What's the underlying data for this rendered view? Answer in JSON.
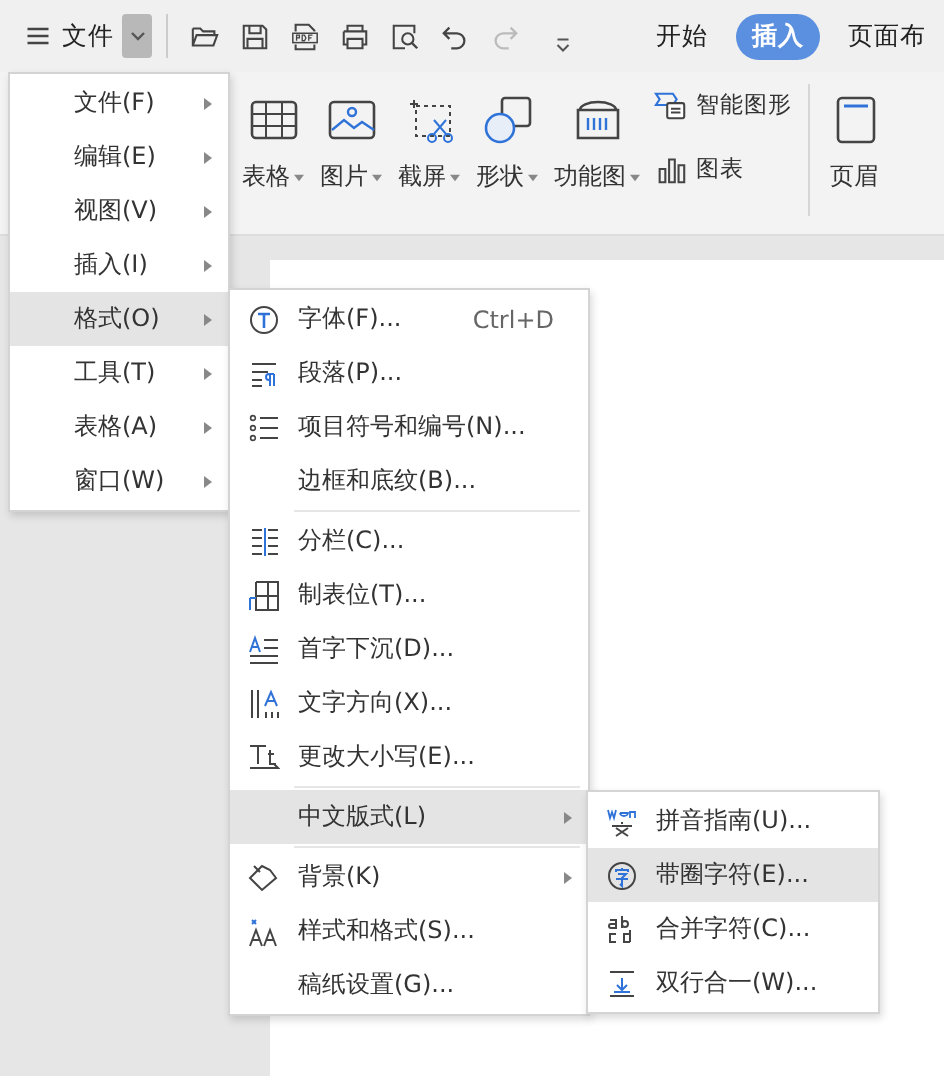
{
  "toolbar": {
    "menu_label": "文件",
    "tabs": [
      {
        "label": "开始",
        "selected": false
      },
      {
        "label": "插入",
        "selected": true
      },
      {
        "label": "页面布",
        "selected": false
      }
    ]
  },
  "ribbon": {
    "items": [
      {
        "label": "表格",
        "kind": "large"
      },
      {
        "label": "图片",
        "kind": "large"
      },
      {
        "label": "截屏",
        "kind": "large"
      },
      {
        "label": "形状",
        "kind": "large"
      },
      {
        "label": "功能图",
        "kind": "large"
      },
      {
        "label": "智能图形",
        "kind": "small"
      },
      {
        "label": "图表",
        "kind": "small"
      },
      {
        "label": "页眉",
        "kind": "cut"
      }
    ]
  },
  "main_menu": {
    "items": [
      {
        "label": "文件(F)",
        "selected": false
      },
      {
        "label": "编辑(E)",
        "selected": false
      },
      {
        "label": "视图(V)",
        "selected": false
      },
      {
        "label": "插入(I)",
        "selected": false
      },
      {
        "label": "格式(O)",
        "selected": true
      },
      {
        "label": "工具(T)",
        "selected": false
      },
      {
        "label": "表格(A)",
        "selected": false
      },
      {
        "label": "窗口(W)",
        "selected": false
      }
    ]
  },
  "format_menu": {
    "items": [
      {
        "kind": "item",
        "label": "字体(F)...",
        "shortcut": "Ctrl+D",
        "selected": false,
        "has_submenu": false
      },
      {
        "kind": "item",
        "label": "段落(P)...",
        "selected": false,
        "has_submenu": false
      },
      {
        "kind": "item",
        "label": "项目符号和编号(N)...",
        "selected": false,
        "has_submenu": false
      },
      {
        "kind": "item",
        "label": "边框和底纹(B)...",
        "selected": false,
        "has_submenu": false
      },
      {
        "kind": "separator"
      },
      {
        "kind": "item",
        "label": "分栏(C)...",
        "selected": false,
        "has_submenu": false
      },
      {
        "kind": "item",
        "label": "制表位(T)...",
        "selected": false,
        "has_submenu": false
      },
      {
        "kind": "item",
        "label": "首字下沉(D)...",
        "selected": false,
        "has_submenu": false
      },
      {
        "kind": "item",
        "label": "文字方向(X)...",
        "selected": false,
        "has_submenu": false
      },
      {
        "kind": "item",
        "label": "更改大小写(E)...",
        "selected": false,
        "has_submenu": false
      },
      {
        "kind": "separator"
      },
      {
        "kind": "item",
        "label": "中文版式(L)",
        "selected": true,
        "has_submenu": true
      },
      {
        "kind": "separator"
      },
      {
        "kind": "item",
        "label": "背景(K)",
        "selected": false,
        "has_submenu": true
      },
      {
        "kind": "item",
        "label": "样式和格式(S)...",
        "selected": false,
        "has_submenu": false
      },
      {
        "kind": "item",
        "label": "稿纸设置(G)...",
        "selected": false,
        "has_submenu": false
      }
    ]
  },
  "chinese_layout_menu": {
    "items": [
      {
        "label": "拼音指南(U)...",
        "selected": false
      },
      {
        "label": "带圈字符(E)...",
        "selected": true
      },
      {
        "label": "合并字符(C)...",
        "selected": false
      },
      {
        "label": "双行合一(W)...",
        "selected": false
      }
    ]
  }
}
